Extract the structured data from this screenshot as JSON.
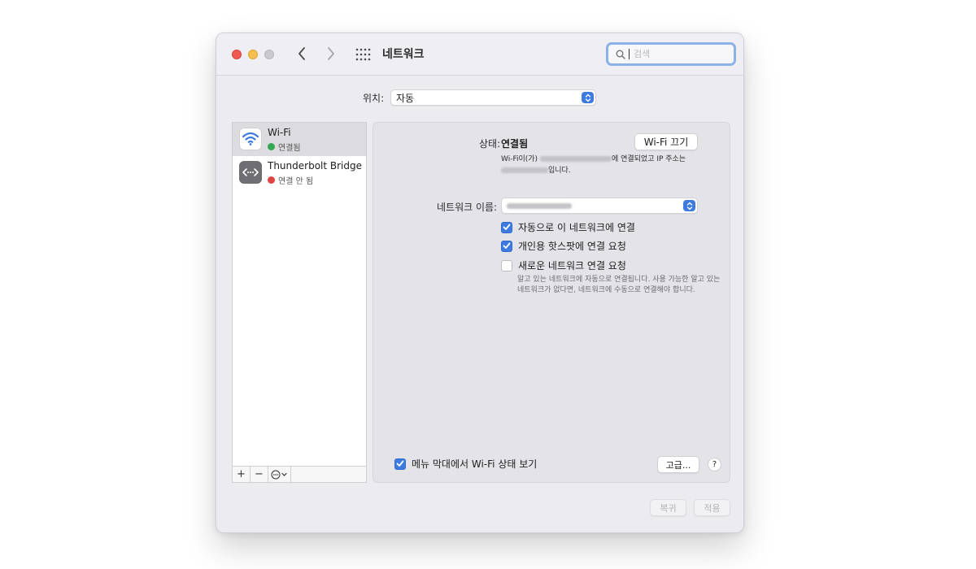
{
  "window": {
    "title": "네트워크",
    "search_placeholder": "검색"
  },
  "icons": [
    "back-chevron-icon",
    "forward-chevron-icon",
    "grid-icon",
    "search-icon",
    "wifi-icon",
    "thunderbolt-icon",
    "checkmark-icon",
    "popup-arrows-icon",
    "ellipsis-circle-icon"
  ],
  "location": {
    "label": "위치:",
    "value": "자동"
  },
  "services": [
    {
      "name": "Wi-Fi",
      "status": "연결됨",
      "status_color": "#34a853",
      "selected": true
    },
    {
      "name": "Thunderbolt Bridge",
      "status": "연결 안 됨",
      "status_color": "#e0443e",
      "selected": false
    }
  ],
  "sidebar_toolbar": {
    "add": "+",
    "remove": "−"
  },
  "detail": {
    "status_label": "상태:",
    "status_value": "연결됨",
    "wifi_off_button": "Wi-Fi 끄기",
    "desc_line1_prefix": "Wi-Fi이(가)",
    "desc_line1_suffix": "에 연결되었고 IP 주소는",
    "desc_line2_suffix": "입니다.",
    "network_name_label": "네트워크 이름:",
    "checkboxes": [
      {
        "label": "자동으로 이 네트워크에 연결",
        "checked": true
      },
      {
        "label": "개인용 핫스팟에 연결 요청",
        "checked": true
      },
      {
        "label": "새로운 네트워크 연결 요청",
        "checked": false
      }
    ],
    "hint": "알고 있는 네트워크에 자동으로 연결됩니다. 사용 가능한 알고 있는 네트워크가 없다면, 네트워크에 수동으로 연결해야 합니다.",
    "menubar_checkbox": {
      "label": "메뉴 막대에서 Wi-Fi 상태 보기",
      "checked": true
    },
    "advanced_button": "고급...",
    "help_button": "?"
  },
  "footer": {
    "revert_button": "복귀",
    "apply_button": "적용"
  },
  "colors": {
    "accent": "#3d7be0",
    "window_bg": "#ecebef"
  }
}
